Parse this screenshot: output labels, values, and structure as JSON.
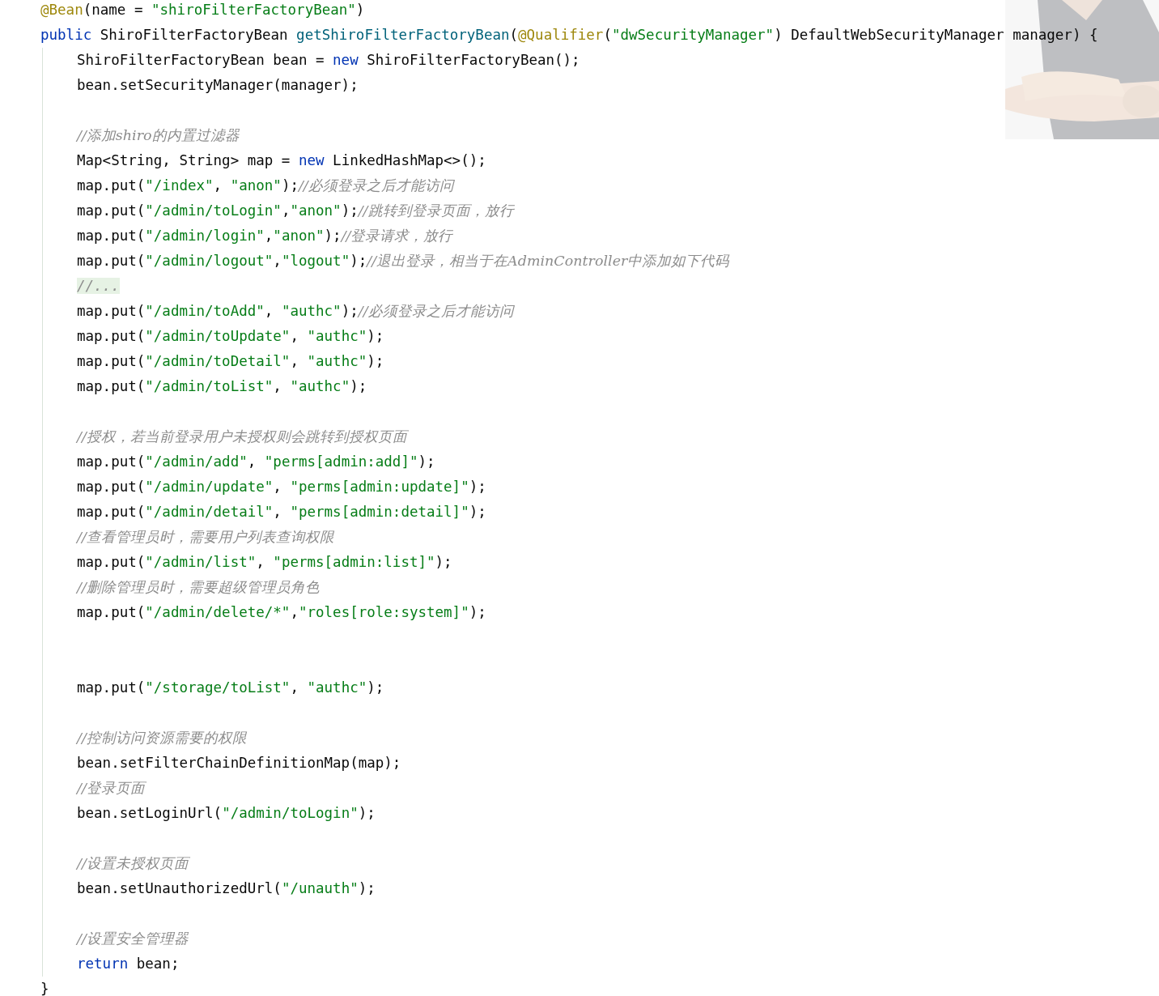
{
  "editor": {
    "header": [
      [
        {
          "kind": "annotation",
          "text": "@Bean"
        },
        {
          "kind": "plain",
          "text": "(name = "
        },
        {
          "kind": "string",
          "text": "\"shiroFilterFactoryBean\""
        },
        {
          "kind": "plain",
          "text": ")"
        }
      ],
      [
        {
          "kind": "keyword",
          "text": "public "
        },
        {
          "kind": "plain",
          "text": "ShiroFilterFactoryBean "
        },
        {
          "kind": "method",
          "text": "getShiroFilterFactoryBean"
        },
        {
          "kind": "plain",
          "text": "("
        },
        {
          "kind": "annotation",
          "text": "@Qualifier"
        },
        {
          "kind": "plain",
          "text": "("
        },
        {
          "kind": "string",
          "text": "\"dwSecurityManager\""
        },
        {
          "kind": "plain",
          "text": ") DefaultWebSecurityManager manager) {"
        }
      ]
    ],
    "body": [
      {
        "tokens": [
          {
            "kind": "plain",
            "text": "ShiroFilterFactoryBean bean = "
          },
          {
            "kind": "keyword",
            "text": "new "
          },
          {
            "kind": "plain",
            "text": "ShiroFilterFactoryBean();"
          }
        ]
      },
      {
        "tokens": [
          {
            "kind": "plain",
            "text": "bean.setSecurityManager(manager);"
          }
        ]
      },
      {
        "kind": "blank"
      },
      {
        "tokens": [
          {
            "kind": "comment",
            "text": "//添加shiro的内置过滤器"
          }
        ]
      },
      {
        "tokens": [
          {
            "kind": "plain",
            "text": "Map<String, String> map = "
          },
          {
            "kind": "keyword",
            "text": "new "
          },
          {
            "kind": "plain",
            "text": "LinkedHashMap<>();"
          }
        ]
      },
      {
        "tokens": [
          {
            "kind": "plain",
            "text": "map.put("
          },
          {
            "kind": "string",
            "text": "\"/index\""
          },
          {
            "kind": "plain",
            "text": ", "
          },
          {
            "kind": "string",
            "text": "\"anon\""
          },
          {
            "kind": "plain",
            "text": ");"
          },
          {
            "kind": "comment",
            "text": "//必须登录之后才能访问"
          }
        ]
      },
      {
        "tokens": [
          {
            "kind": "plain",
            "text": "map.put("
          },
          {
            "kind": "string",
            "text": "\"/admin/toLogin\""
          },
          {
            "kind": "plain",
            "text": ","
          },
          {
            "kind": "string",
            "text": "\"anon\""
          },
          {
            "kind": "plain",
            "text": ");"
          },
          {
            "kind": "comment",
            "text": "//跳转到登录页面，放行"
          }
        ]
      },
      {
        "tokens": [
          {
            "kind": "plain",
            "text": "map.put("
          },
          {
            "kind": "string",
            "text": "\"/admin/login\""
          },
          {
            "kind": "plain",
            "text": ","
          },
          {
            "kind": "string",
            "text": "\"anon\""
          },
          {
            "kind": "plain",
            "text": ");"
          },
          {
            "kind": "comment",
            "text": "//登录请求，放行"
          }
        ]
      },
      {
        "tokens": [
          {
            "kind": "plain",
            "text": "map.put("
          },
          {
            "kind": "string",
            "text": "\"/admin/logout\""
          },
          {
            "kind": "plain",
            "text": ","
          },
          {
            "kind": "string",
            "text": "\"logout\""
          },
          {
            "kind": "plain",
            "text": ");"
          },
          {
            "kind": "comment",
            "text": "//退出登录，相当于在AdminController中添加如下代码"
          }
        ]
      },
      {
        "tokens": [
          {
            "kind": "folded",
            "text": "//..."
          }
        ]
      },
      {
        "tokens": [
          {
            "kind": "plain",
            "text": "map.put("
          },
          {
            "kind": "string",
            "text": "\"/admin/toAdd\""
          },
          {
            "kind": "plain",
            "text": ", "
          },
          {
            "kind": "string",
            "text": "\"authc\""
          },
          {
            "kind": "plain",
            "text": ");"
          },
          {
            "kind": "comment",
            "text": "//必须登录之后才能访问"
          }
        ]
      },
      {
        "tokens": [
          {
            "kind": "plain",
            "text": "map.put("
          },
          {
            "kind": "string",
            "text": "\"/admin/toUpdate\""
          },
          {
            "kind": "plain",
            "text": ", "
          },
          {
            "kind": "string",
            "text": "\"authc\""
          },
          {
            "kind": "plain",
            "text": ");"
          }
        ]
      },
      {
        "tokens": [
          {
            "kind": "plain",
            "text": "map.put("
          },
          {
            "kind": "string",
            "text": "\"/admin/toDetail\""
          },
          {
            "kind": "plain",
            "text": ", "
          },
          {
            "kind": "string",
            "text": "\"authc\""
          },
          {
            "kind": "plain",
            "text": ");"
          }
        ]
      },
      {
        "tokens": [
          {
            "kind": "plain",
            "text": "map.put("
          },
          {
            "kind": "string",
            "text": "\"/admin/toList\""
          },
          {
            "kind": "plain",
            "text": ", "
          },
          {
            "kind": "string",
            "text": "\"authc\""
          },
          {
            "kind": "plain",
            "text": ");"
          }
        ]
      },
      {
        "kind": "blank"
      },
      {
        "tokens": [
          {
            "kind": "comment",
            "text": "//授权，若当前登录用户未授权则会跳转到授权页面"
          }
        ]
      },
      {
        "tokens": [
          {
            "kind": "plain",
            "text": "map.put("
          },
          {
            "kind": "string",
            "text": "\"/admin/add\""
          },
          {
            "kind": "plain",
            "text": ", "
          },
          {
            "kind": "string",
            "text": "\"perms[admin:add]\""
          },
          {
            "kind": "plain",
            "text": ");"
          }
        ]
      },
      {
        "tokens": [
          {
            "kind": "plain",
            "text": "map.put("
          },
          {
            "kind": "string",
            "text": "\"/admin/update\""
          },
          {
            "kind": "plain",
            "text": ", "
          },
          {
            "kind": "string",
            "text": "\"perms[admin:update]\""
          },
          {
            "kind": "plain",
            "text": ");"
          }
        ]
      },
      {
        "tokens": [
          {
            "kind": "plain",
            "text": "map.put("
          },
          {
            "kind": "string",
            "text": "\"/admin/detail\""
          },
          {
            "kind": "plain",
            "text": ", "
          },
          {
            "kind": "string",
            "text": "\"perms[admin:detail]\""
          },
          {
            "kind": "plain",
            "text": ");"
          }
        ]
      },
      {
        "tokens": [
          {
            "kind": "comment",
            "text": "//查看管理员时，需要用户列表查询权限"
          }
        ]
      },
      {
        "tokens": [
          {
            "kind": "plain",
            "text": "map.put("
          },
          {
            "kind": "string",
            "text": "\"/admin/list\""
          },
          {
            "kind": "plain",
            "text": ", "
          },
          {
            "kind": "string",
            "text": "\"perms[admin:list]\""
          },
          {
            "kind": "plain",
            "text": ");"
          }
        ]
      },
      {
        "tokens": [
          {
            "kind": "comment",
            "text": "//删除管理员时，需要超级管理员角色"
          }
        ]
      },
      {
        "tokens": [
          {
            "kind": "plain",
            "text": "map.put("
          },
          {
            "kind": "string",
            "text": "\"/admin/delete/*\""
          },
          {
            "kind": "plain",
            "text": ","
          },
          {
            "kind": "string",
            "text": "\"roles[role:system]\""
          },
          {
            "kind": "plain",
            "text": ");"
          }
        ]
      },
      {
        "kind": "blank"
      },
      {
        "kind": "blank"
      },
      {
        "tokens": [
          {
            "kind": "plain",
            "text": "map.put("
          },
          {
            "kind": "string",
            "text": "\"/storage/toList\""
          },
          {
            "kind": "plain",
            "text": ", "
          },
          {
            "kind": "string",
            "text": "\"authc\""
          },
          {
            "kind": "plain",
            "text": ");"
          }
        ]
      },
      {
        "kind": "blank"
      },
      {
        "tokens": [
          {
            "kind": "comment",
            "text": "//控制访问资源需要的权限"
          }
        ]
      },
      {
        "tokens": [
          {
            "kind": "plain",
            "text": "bean.setFilterChainDefinitionMap(map);"
          }
        ]
      },
      {
        "tokens": [
          {
            "kind": "comment",
            "text": "//登录页面"
          }
        ]
      },
      {
        "tokens": [
          {
            "kind": "plain",
            "text": "bean.setLoginUrl("
          },
          {
            "kind": "string",
            "text": "\"/admin/toLogin\""
          },
          {
            "kind": "plain",
            "text": ");"
          }
        ]
      },
      {
        "kind": "blank"
      },
      {
        "tokens": [
          {
            "kind": "comment",
            "text": "//设置未授权页面"
          }
        ]
      },
      {
        "tokens": [
          {
            "kind": "plain",
            "text": "bean.setUnauthorizedUrl("
          },
          {
            "kind": "string",
            "text": "\"/unauth\""
          },
          {
            "kind": "plain",
            "text": ");"
          }
        ]
      },
      {
        "kind": "blank"
      },
      {
        "tokens": [
          {
            "kind": "comment",
            "text": "//设置安全管理器"
          }
        ]
      },
      {
        "tokens": [
          {
            "kind": "keyword",
            "text": "return "
          },
          {
            "kind": "plain",
            "text": "bean;"
          }
        ]
      }
    ],
    "closing": "}"
  }
}
